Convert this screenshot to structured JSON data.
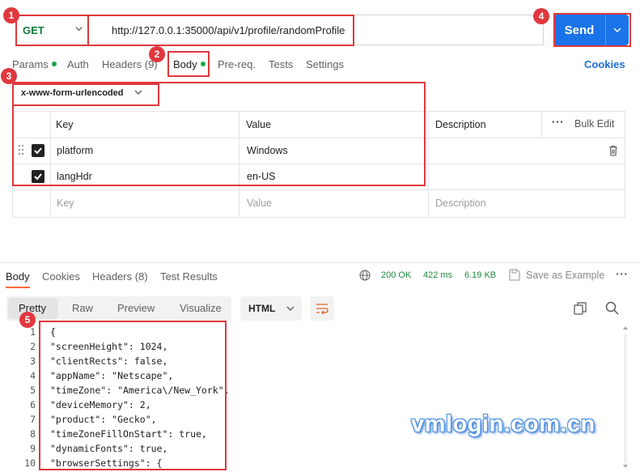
{
  "request": {
    "method": "GET",
    "url": "http://127.0.0.1:35000/api/v1/profile/randomProfile",
    "send_label": "Send"
  },
  "request_tabs": [
    {
      "label": "Params"
    },
    {
      "label": "Auth"
    },
    {
      "label": "Headers (9)"
    },
    {
      "label": "Body"
    },
    {
      "label": "Pre-req."
    },
    {
      "label": "Tests"
    },
    {
      "label": "Settings"
    }
  ],
  "cookies_link": "Cookies",
  "body_type": "x-www-form-urlencoded",
  "table": {
    "headers": {
      "key": "Key",
      "value": "Value",
      "description": "Description",
      "bulk_edit": "Bulk Edit"
    },
    "rows": [
      {
        "key": "platform",
        "value": "Windows",
        "checked": true
      },
      {
        "key": "langHdr",
        "value": "en-US",
        "checked": true
      }
    ],
    "placeholder": {
      "key": "Key",
      "value": "Value",
      "description": "Description"
    }
  },
  "response_tabs": [
    {
      "label": "Body"
    },
    {
      "label": "Cookies"
    },
    {
      "label": "Headers (8)"
    },
    {
      "label": "Test Results"
    }
  ],
  "status": {
    "code": "200 OK",
    "time": "422 ms",
    "size": "6.19 KB",
    "save_label": "Save as Example"
  },
  "view_tabs": [
    {
      "label": "Pretty"
    },
    {
      "label": "Raw"
    },
    {
      "label": "Preview"
    },
    {
      "label": "Visualize"
    }
  ],
  "format": "HTML",
  "code_lines": [
    {
      "n": "1",
      "text": "{"
    },
    {
      "n": "2",
      "text": "\"screenHeight\": 1024,"
    },
    {
      "n": "3",
      "text": "\"clientRects\": false,"
    },
    {
      "n": "4",
      "text": "\"appName\": \"Netscape\","
    },
    {
      "n": "5",
      "text": "\"timeZone\": \"America\\/New_York\","
    },
    {
      "n": "6",
      "text": "\"deviceMemory\": 2,"
    },
    {
      "n": "7",
      "text": "\"product\": \"Gecko\","
    },
    {
      "n": "8",
      "text": "\"timeZoneFillOnStart\": true,"
    },
    {
      "n": "9",
      "text": "\"dynamicFonts\": true,"
    },
    {
      "n": "10",
      "text": "\"browserSettings\": {"
    }
  ],
  "annotations": [
    "1",
    "2",
    "3",
    "4",
    "5"
  ],
  "watermark": "vmlogin.com.cn",
  "colors": {
    "accent": "#1a73e8",
    "annotation": "#e0383e",
    "method": "#0f7b3c",
    "status": "#1f8a3a"
  }
}
